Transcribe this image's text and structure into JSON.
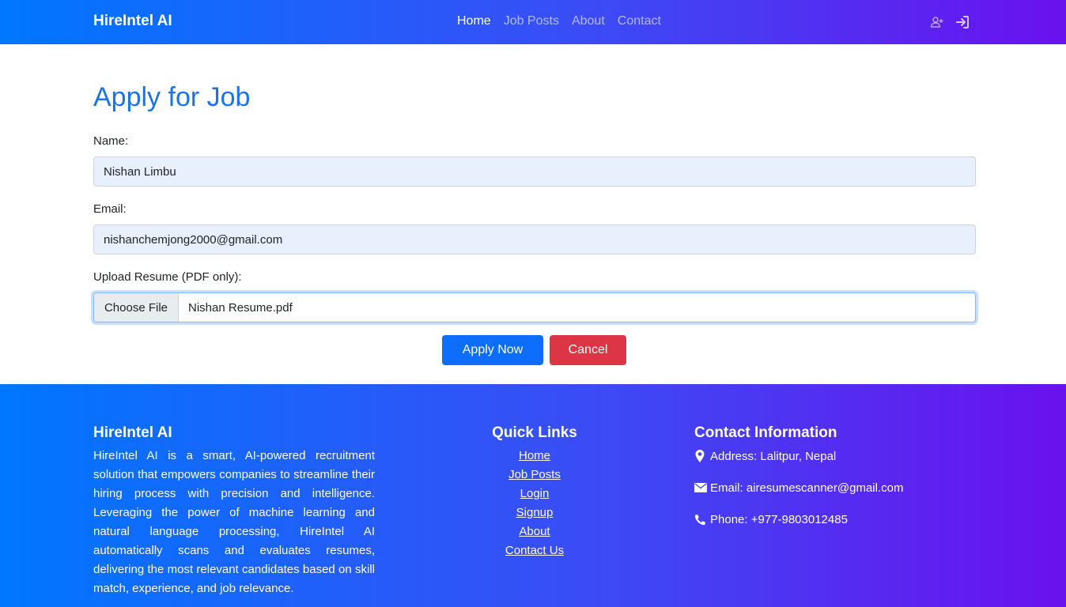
{
  "navbar": {
    "brand": "HireIntel AI",
    "links": [
      {
        "label": "Home",
        "active": true
      },
      {
        "label": "Job Posts",
        "active": false
      },
      {
        "label": "About",
        "active": false
      },
      {
        "label": "Contact",
        "active": false
      }
    ],
    "icons": [
      "user-plus-icon",
      "sign-in-icon"
    ]
  },
  "form": {
    "title": "Apply for Job",
    "name_label": "Name:",
    "name_value": "Nishan Limbu",
    "email_label": "Email:",
    "email_value": "nishanchemjong2000@gmail.com",
    "resume_label": "Upload Resume (PDF only):",
    "file_button": "Choose File",
    "file_name": "Nishan Resume.pdf",
    "submit_label": "Apply Now",
    "cancel_label": "Cancel"
  },
  "footer": {
    "about": {
      "title": "HireIntel AI",
      "text": "HireIntel AI is a smart, AI-powered recruitment solution that empowers companies to streamline their hiring process with precision and intelligence. Leveraging the power of machine learning and natural language processing, HireIntel AI automatically scans and evaluates resumes, delivering the most relevant candidates based on skill match, experience, and job relevance."
    },
    "quick_links": {
      "title": "Quick Links",
      "items": [
        "Home",
        "Job Posts",
        "Login",
        "Signup",
        "About",
        "Contact Us"
      ]
    },
    "contact": {
      "title": "Contact Information",
      "address": "Address: Lalitpur, Nepal",
      "email": "Email: airesumescanner@gmail.com",
      "phone": "Phone: +977-9803012485"
    }
  },
  "colors": {
    "gradient_start": "#0077ff",
    "gradient_end": "#6a11ee",
    "title_blue": "#1a73e8",
    "primary": "#0d6efd",
    "danger": "#dc3545",
    "input_fill": "#e8f0fe"
  }
}
